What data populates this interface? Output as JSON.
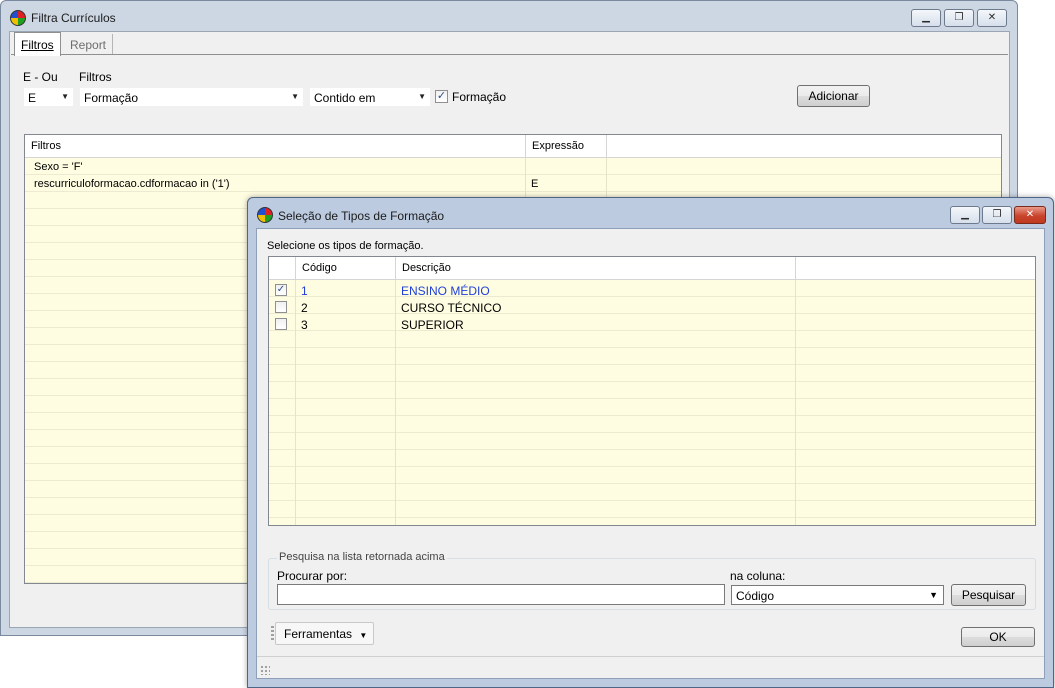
{
  "main_window": {
    "title": "Filtra Currículos",
    "tabs": [
      {
        "label": "Filtros",
        "active": true
      },
      {
        "label": "Report",
        "active": false
      }
    ],
    "label_e_ou": "E - Ou",
    "label_filtros": "Filtros",
    "e_ou_value": "E",
    "filtro_value": "Formação",
    "operador_value": "Contido em",
    "formacao_checkbox": {
      "label": "Formação",
      "checked": true
    },
    "adicionar_button": "Adicionar",
    "grid": {
      "columns": [
        "Filtros",
        "Expressão"
      ],
      "rows": [
        {
          "filtro": "Sexo  =  'F'",
          "expressao": ""
        },
        {
          "filtro": "rescurriculoformacao.cdformacao  in  ('1')",
          "expressao": "E"
        }
      ]
    }
  },
  "dialog": {
    "title": "Seleção de Tipos de Formação",
    "instruction": "Selecione os tipos de formação.",
    "grid": {
      "columns": [
        "",
        "Código",
        "Descrição"
      ],
      "rows": [
        {
          "checked": true,
          "codigo": "1",
          "descricao": "ENSINO MÉDIO"
        },
        {
          "checked": false,
          "codigo": "2",
          "descricao": "CURSO TÉCNICO"
        },
        {
          "checked": false,
          "codigo": "3",
          "descricao": "SUPERIOR"
        }
      ]
    },
    "search": {
      "group_label": "Pesquisa na lista retornada acima",
      "procurar_label": "Procurar por:",
      "procurar_value": "",
      "coluna_label": "na coluna:",
      "coluna_value": "Código",
      "pesquisar_button": "Pesquisar"
    },
    "ferramentas_button": "Ferramentas",
    "ok_button": "OK"
  },
  "colors": {
    "grid_background": "#fffde1",
    "selected_text": "#1f3fd8",
    "close_button": "#c9442d"
  }
}
